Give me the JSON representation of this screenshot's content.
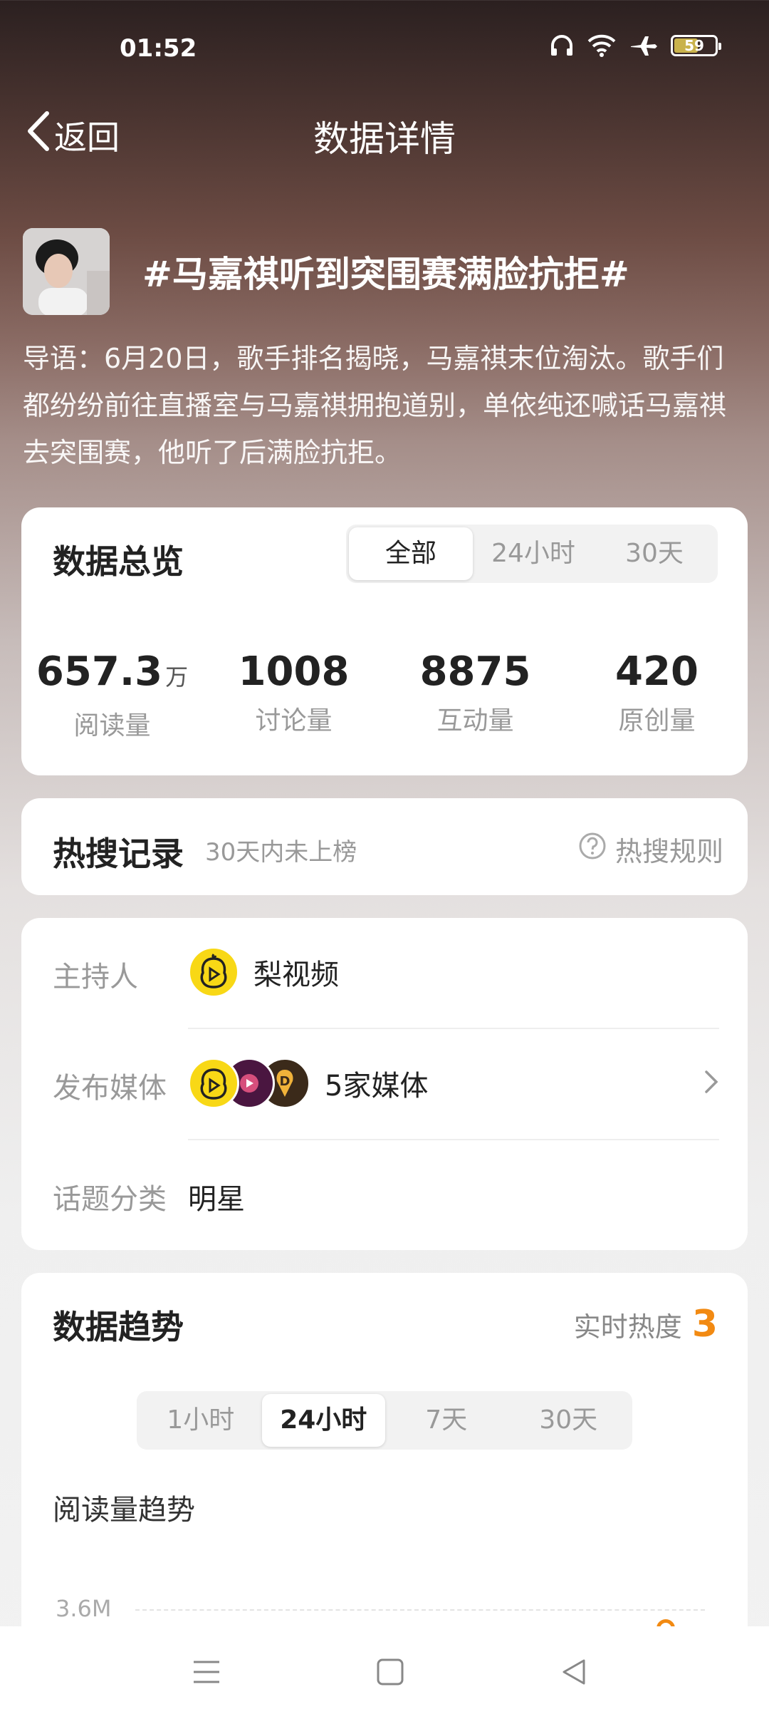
{
  "status": {
    "time": "01:52",
    "battery": "59"
  },
  "nav": {
    "back_label": "返回",
    "title": "数据详情"
  },
  "topic": {
    "title": "#马嘉祺听到突围赛满脸抗拒#",
    "intro": "导语：6月20日，歌手排名揭晓，马嘉祺末位淘汰。歌手们都纷纷前往直播室与马嘉祺拥抱道别，单依纯还喊话马嘉祺去突围赛，他听了后满脸抗拒。"
  },
  "overview": {
    "title": "数据总览",
    "tabs": [
      "全部",
      "24小时",
      "30天"
    ],
    "active_tab": "全部",
    "stats": [
      {
        "value": "657.3",
        "unit": "万",
        "label": "阅读量"
      },
      {
        "value": "1008",
        "unit": "",
        "label": "讨论量"
      },
      {
        "value": "8875",
        "unit": "",
        "label": "互动量"
      },
      {
        "value": "420",
        "unit": "",
        "label": "原创量"
      }
    ]
  },
  "hot_search": {
    "title": "热搜记录",
    "subtitle": "30天内未上榜",
    "rule_label": "热搜规则"
  },
  "info": {
    "host_label": "主持人",
    "host_value": "梨视频",
    "media_label": "发布媒体",
    "media_value": "5家媒体",
    "category_label": "话题分类",
    "category_value": "明星"
  },
  "trend": {
    "title": "数据趋势",
    "realtime_label": "实时热度",
    "realtime_value": "3",
    "tabs": [
      "1小时",
      "24小时",
      "7天",
      "30天"
    ],
    "active_tab": "24小时",
    "subtitle": "阅读量趋势",
    "axis_top": "3.6M"
  },
  "colors": {
    "accent": "#f28a12",
    "logo_yellow": "#f8d816"
  }
}
